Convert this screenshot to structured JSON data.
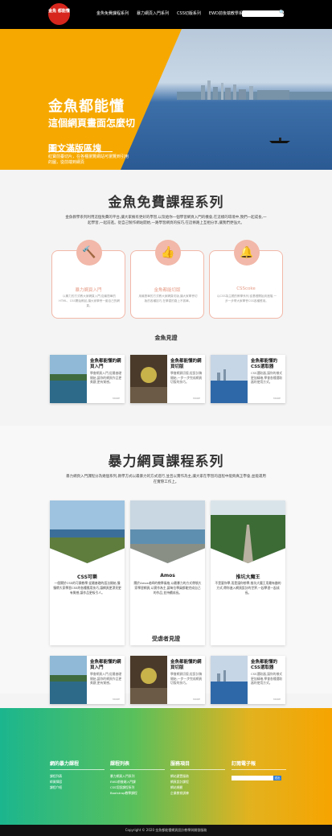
{
  "header": {
    "logo_text": "金魚 都能懂",
    "nav": [
      "金魚免費課程系列",
      "暴力網頁入門系列",
      "CSS切版系列",
      "EWD前後端教學系列"
    ],
    "search_button": "🔍"
  },
  "hero": {
    "title": "金魚都能懂",
    "subtitle": "這個網頁畫面怎麼切",
    "heading": "圖文滿版區塊",
    "text": "紅寶前臺切片，在各種瀏覽網站可瀏覽到引用的圖，從前端到網頁"
  },
  "free": {
    "title": "金魚免費課程系列",
    "desc": "金魚教學系列利用這個免費的平台,讓大家擁有更好的學習,以及給你一個學習網頁入門的機會,在這樣的環境中,我們一起成長,一起學習,一起前進。從自己製作網站開始,一路學習網頁的技巧,在這條路上互相分享,讓我們更強大。",
    "cards": [
      {
        "icon": "🔨",
        "title": "暴力網頁入門",
        "text": "以暴力的方式教大家網頁入門,從最簡單的HTML、CSS開始教起,讓大家學會一套自己的網頁。"
      },
      {
        "icon": "👍",
        "title": "金魚都能切版",
        "text": "用最簡單的方式教大家網頁切版,讓大家學會切版的各種技巧,在學習的路上不孤單。"
      },
      {
        "icon": "🔔",
        "title": "CSScoke",
        "text": "以CSS為主題的教學系列,從基礎開始到進階,一步一步帶大家學會CSS各種應用。"
      }
    ],
    "sub_title": "金魚見證",
    "testimonials": [
      {
        "title": "金魚都能懂的網頁入門",
        "text": "學會網頁入門,從最基礎開始,讓你的網頁作品更美觀,更有質感。",
        "more": "MORE"
      },
      {
        "title": "金魚都能懂的網頁切版",
        "text": "學會網頁切版,從設計稿開始,一步一步完成網頁切版的技巧。",
        "more": "MORE"
      },
      {
        "title": "金魚都能懂的CSS選取器",
        "text": "CSS選取器,讓你的樣式更加精確,學會各種選取器的使用方式。",
        "more": "MORE"
      }
    ]
  },
  "violence": {
    "title": "暴力網頁課程系列",
    "desc": "暴力網頁入門課程分為幾個系列,教學方式以最暴力的方式進行,並且以實作為主,讓大家在學習的過程中能夠真正學會,並能運用在實際工作上。",
    "cards": [
      {
        "title": "CSS可樂",
        "text": "一個關於CSS的可樂教學,從最基礎的語法開始,慢慢帶大家學習CSS的各種應用技巧,讓網頁更漂亮更有質感,讓作品更吸引人。"
      },
      {
        "title": "Amos",
        "text": "關於Amos老師的教學風格,以最暴力的方式帶領大家學習網頁,以實作為主,讓每位學員都能完成自己的作品,並持續成長。"
      },
      {
        "title": "推坑大魔王",
        "text": "不是要你學,而是讓你想學,推坑大魔王用最有趣的方式,帶你進入網頁設計的世界,一起學習一起成長。"
      }
    ],
    "sub_title": "受虐者見證",
    "testimonials": [
      {
        "title": "金魚都能懂的網頁入門",
        "text": "學會網頁入門,從最基礎開始,讓你的網頁作品更美觀,更有質感。",
        "more": "MORE"
      },
      {
        "title": "金魚都能懂的網頁切版",
        "text": "學會網頁切版,從設計稿開始,一步一步完成網頁切版的技巧。",
        "more": "MORE"
      },
      {
        "title": "金魚都能懂的CSS選取器",
        "text": "CSS選取器,讓你的樣式更加精確,學會各種選取器的使用方式。",
        "more": "MORE"
      }
    ]
  },
  "footer": {
    "col1": {
      "title": "網的暴力課程",
      "items": [
        "課程列表",
        "師資陣容",
        "課程介紹"
      ]
    },
    "col2": {
      "title": "課程列表",
      "items": [
        "暴力網頁入門系列",
        "EWD前後端入門課",
        "CSS切版課程系列",
        "Bootstrap教學課程"
      ]
    },
    "col3": {
      "title": "服務項目",
      "items": [
        "網站建置服務",
        "網頁設計課程",
        "網站規劃",
        "企業教育訓練"
      ]
    },
    "col4": {
      "title": "訂閱電子報",
      "button": "送出"
    },
    "copyright": "Copyright © 2020 金魚都能懂網頁設計教學與開發服務"
  }
}
